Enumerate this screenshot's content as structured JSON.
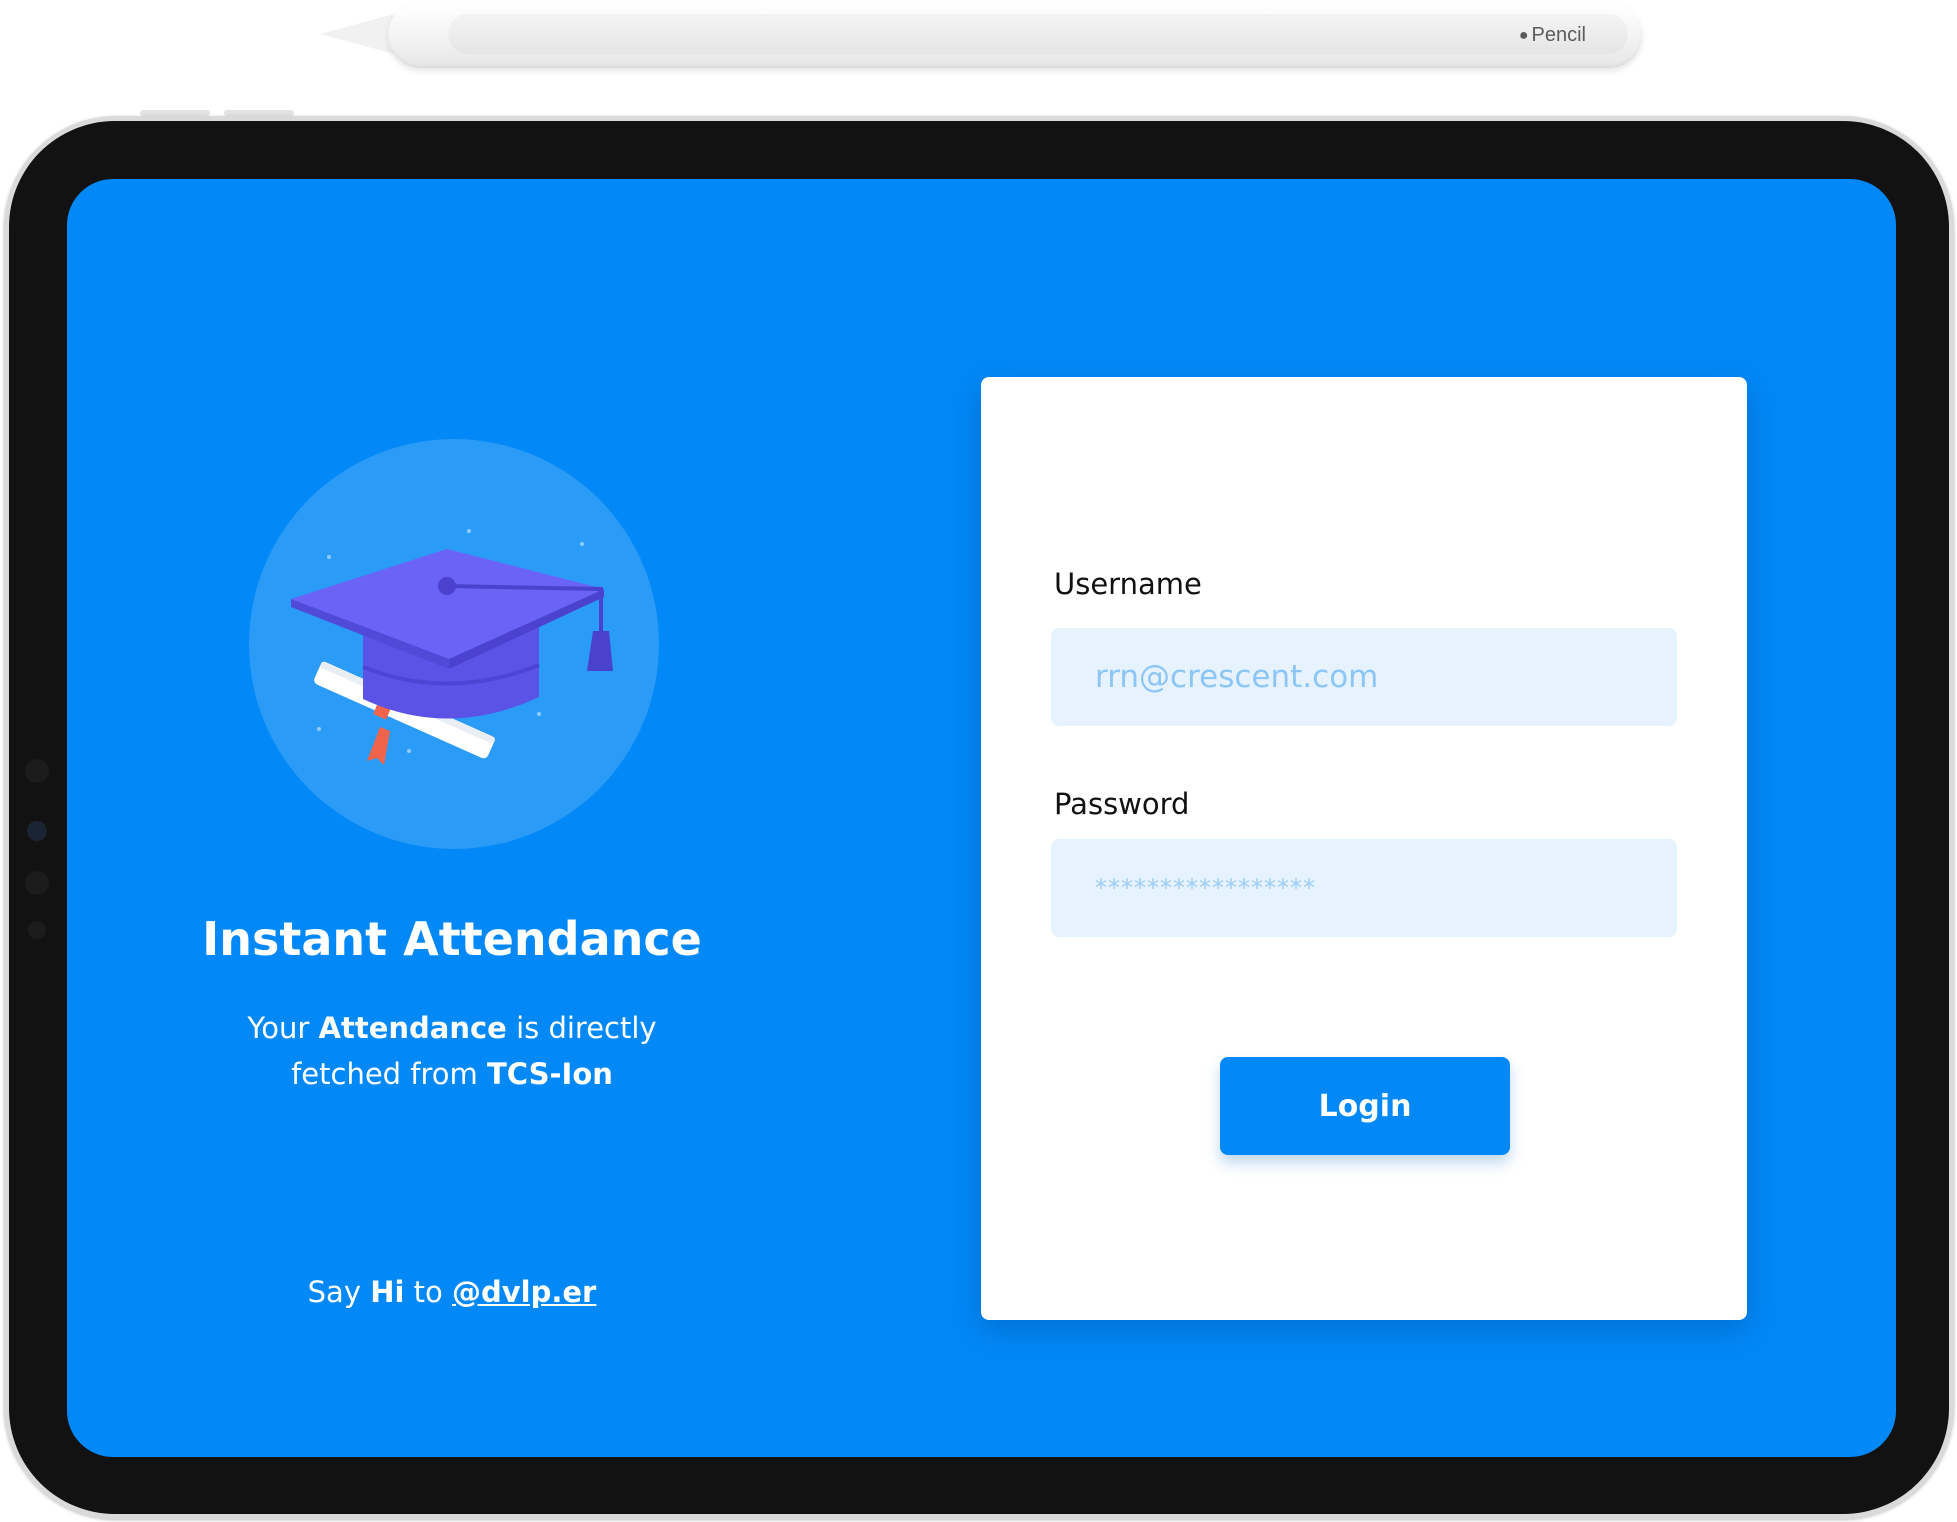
{
  "pencil": {
    "brand": "Pencil"
  },
  "hero": {
    "title": "Instant Attendance",
    "desc_line1_pre": "Your ",
    "desc_line1_bold": "Attendance",
    "desc_line1_post": " is directly",
    "desc_line2_pre": "fetched from ",
    "desc_line2_bold": "TCS-Ion",
    "footer_pre": "Say ",
    "footer_bold": "Hi",
    "footer_mid": " to ",
    "footer_link": "@dvlp.er"
  },
  "login": {
    "username_label": "Username",
    "username_placeholder": "rrn@crescent.com",
    "password_label": "Password",
    "password_placeholder": "*****************",
    "button_label": "Login"
  },
  "colors": {
    "screen_bg": "#0288f7",
    "hero_circle": "#2b9bf8",
    "input_bg": "#e6f3ff",
    "cap": "#6a63f6",
    "ribbon": "#f0644b"
  }
}
